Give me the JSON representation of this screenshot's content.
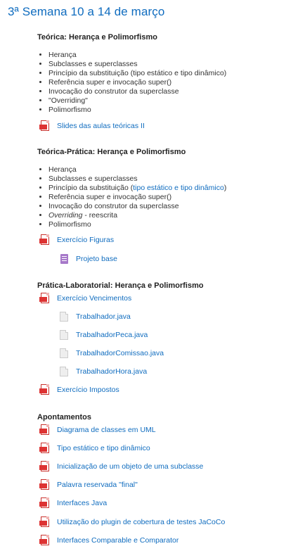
{
  "week_title": "3ª Semana 10 a 14 de março",
  "s1": {
    "title": "Teórica: Herança e Polimorfismo",
    "bullets": [
      "Herança",
      "Subclasses e superclasses",
      "Princípio da substituição (tipo estático e tipo dinâmico)",
      "Referência super e invocação super()",
      "Invocação do construtor da superclasse",
      "\"Overriding\"",
      "Polimorfismo"
    ],
    "resources": [
      "Slides das aulas teóricas II"
    ]
  },
  "s2": {
    "title": "Teórica-Prática: Herança e Polimorfismo",
    "bullets": [
      "Herança",
      "Subclasses e superclasses",
      "Princípio da substituição (",
      "tipo estático e tipo dinâmico",
      ")",
      "Referência super e invocação super()",
      "Invocação do construtor da superclasse",
      "Overriding",
      " - reescrita",
      "Polimorfismo"
    ],
    "resources": [
      "Exercício Figuras",
      "Projeto base"
    ]
  },
  "s3": {
    "title": "Prática-Laboratorial: Herança e Polimorfismo",
    "resources": [
      "Exercício Vencimentos",
      "Trabalhador.java",
      "TrabalhadorPeca.java",
      "TrabalhadorComissao.java",
      "TrabalhadorHora.java",
      "Exercício Impostos"
    ]
  },
  "s4": {
    "title": "Apontamentos",
    "resources": [
      "Diagrama de classes em UML",
      "Tipo estático e tipo dinâmico",
      "Inicialização de um objeto de uma subclasse",
      "Palavra reservada \"final\"",
      "Interfaces Java",
      "Utilização do plugin de cobertura de testes JaCoCo",
      "Interfaces Comparable e Comparator"
    ]
  },
  "icons": {
    "pdf": "pdf-icon",
    "file": "file-icon",
    "archive": "archive-icon"
  },
  "colors": {
    "link": "#0f6cbf",
    "pdf": "#d33333",
    "archive": "#a678c9"
  }
}
